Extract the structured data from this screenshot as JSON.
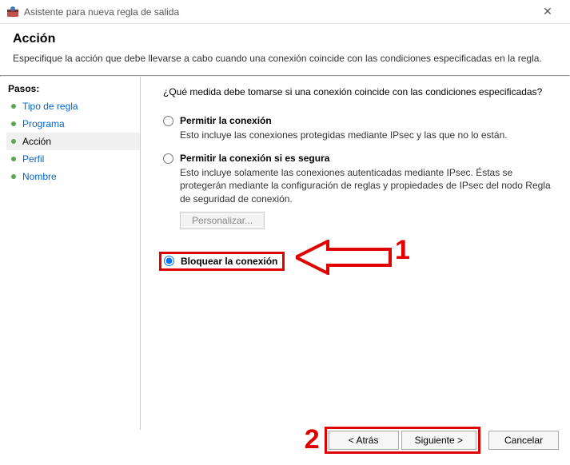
{
  "window": {
    "title": "Asistente para nueva regla de salida",
    "close_glyph": "✕"
  },
  "header": {
    "title": "Acción",
    "description": "Especifique la acción que debe llevarse a cabo cuando una conexión coincide con las condiciones especificadas en la regla."
  },
  "sidebar": {
    "title": "Pasos:",
    "steps": [
      {
        "label": "Tipo de regla"
      },
      {
        "label": "Programa"
      },
      {
        "label": "Acción"
      },
      {
        "label": "Perfil"
      },
      {
        "label": "Nombre"
      }
    ],
    "active_index": 2
  },
  "content": {
    "prompt": "¿Qué medida debe tomarse si una conexión coincide con las condiciones especificadas?",
    "options": {
      "allow": {
        "label": "Permitir la conexión",
        "sub": "Esto incluye las conexiones protegidas mediante IPsec y las que no lo están."
      },
      "allow_secure": {
        "label": "Permitir la conexión si es segura",
        "sub": "Esto incluye solamente las conexiones autenticadas mediante IPsec. Éstas se protegerán mediante la configuración de reglas y propiedades de IPsec del nodo Regla de seguridad de conexión."
      },
      "block": {
        "label": "Bloquear la conexión"
      },
      "customize_btn": "Personalizar..."
    }
  },
  "footer": {
    "back": "< Atrás",
    "next": "Siguiente >",
    "cancel": "Cancelar"
  },
  "annotations": {
    "one": "1",
    "two": "2"
  }
}
